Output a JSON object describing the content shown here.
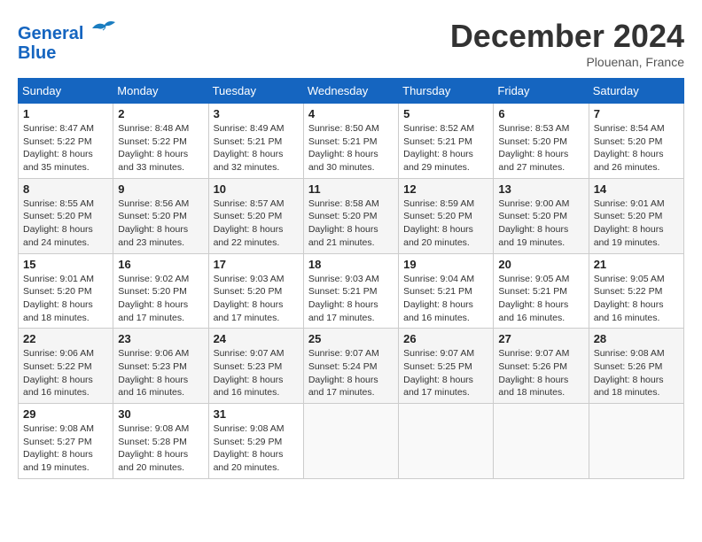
{
  "header": {
    "logo_line1": "General",
    "logo_line2": "Blue",
    "month_title": "December 2024",
    "subtitle": "Plouenan, France"
  },
  "weekdays": [
    "Sunday",
    "Monday",
    "Tuesday",
    "Wednesday",
    "Thursday",
    "Friday",
    "Saturday"
  ],
  "weeks": [
    [
      {
        "day": "1",
        "info": "Sunrise: 8:47 AM\nSunset: 5:22 PM\nDaylight: 8 hours\nand 35 minutes."
      },
      {
        "day": "2",
        "info": "Sunrise: 8:48 AM\nSunset: 5:22 PM\nDaylight: 8 hours\nand 33 minutes."
      },
      {
        "day": "3",
        "info": "Sunrise: 8:49 AM\nSunset: 5:21 PM\nDaylight: 8 hours\nand 32 minutes."
      },
      {
        "day": "4",
        "info": "Sunrise: 8:50 AM\nSunset: 5:21 PM\nDaylight: 8 hours\nand 30 minutes."
      },
      {
        "day": "5",
        "info": "Sunrise: 8:52 AM\nSunset: 5:21 PM\nDaylight: 8 hours\nand 29 minutes."
      },
      {
        "day": "6",
        "info": "Sunrise: 8:53 AM\nSunset: 5:20 PM\nDaylight: 8 hours\nand 27 minutes."
      },
      {
        "day": "7",
        "info": "Sunrise: 8:54 AM\nSunset: 5:20 PM\nDaylight: 8 hours\nand 26 minutes."
      }
    ],
    [
      {
        "day": "8",
        "info": "Sunrise: 8:55 AM\nSunset: 5:20 PM\nDaylight: 8 hours\nand 24 minutes."
      },
      {
        "day": "9",
        "info": "Sunrise: 8:56 AM\nSunset: 5:20 PM\nDaylight: 8 hours\nand 23 minutes."
      },
      {
        "day": "10",
        "info": "Sunrise: 8:57 AM\nSunset: 5:20 PM\nDaylight: 8 hours\nand 22 minutes."
      },
      {
        "day": "11",
        "info": "Sunrise: 8:58 AM\nSunset: 5:20 PM\nDaylight: 8 hours\nand 21 minutes."
      },
      {
        "day": "12",
        "info": "Sunrise: 8:59 AM\nSunset: 5:20 PM\nDaylight: 8 hours\nand 20 minutes."
      },
      {
        "day": "13",
        "info": "Sunrise: 9:00 AM\nSunset: 5:20 PM\nDaylight: 8 hours\nand 19 minutes."
      },
      {
        "day": "14",
        "info": "Sunrise: 9:01 AM\nSunset: 5:20 PM\nDaylight: 8 hours\nand 19 minutes."
      }
    ],
    [
      {
        "day": "15",
        "info": "Sunrise: 9:01 AM\nSunset: 5:20 PM\nDaylight: 8 hours\nand 18 minutes."
      },
      {
        "day": "16",
        "info": "Sunrise: 9:02 AM\nSunset: 5:20 PM\nDaylight: 8 hours\nand 17 minutes."
      },
      {
        "day": "17",
        "info": "Sunrise: 9:03 AM\nSunset: 5:20 PM\nDaylight: 8 hours\nand 17 minutes."
      },
      {
        "day": "18",
        "info": "Sunrise: 9:03 AM\nSunset: 5:21 PM\nDaylight: 8 hours\nand 17 minutes."
      },
      {
        "day": "19",
        "info": "Sunrise: 9:04 AM\nSunset: 5:21 PM\nDaylight: 8 hours\nand 16 minutes."
      },
      {
        "day": "20",
        "info": "Sunrise: 9:05 AM\nSunset: 5:21 PM\nDaylight: 8 hours\nand 16 minutes."
      },
      {
        "day": "21",
        "info": "Sunrise: 9:05 AM\nSunset: 5:22 PM\nDaylight: 8 hours\nand 16 minutes."
      }
    ],
    [
      {
        "day": "22",
        "info": "Sunrise: 9:06 AM\nSunset: 5:22 PM\nDaylight: 8 hours\nand 16 minutes."
      },
      {
        "day": "23",
        "info": "Sunrise: 9:06 AM\nSunset: 5:23 PM\nDaylight: 8 hours\nand 16 minutes."
      },
      {
        "day": "24",
        "info": "Sunrise: 9:07 AM\nSunset: 5:23 PM\nDaylight: 8 hours\nand 16 minutes."
      },
      {
        "day": "25",
        "info": "Sunrise: 9:07 AM\nSunset: 5:24 PM\nDaylight: 8 hours\nand 17 minutes."
      },
      {
        "day": "26",
        "info": "Sunrise: 9:07 AM\nSunset: 5:25 PM\nDaylight: 8 hours\nand 17 minutes."
      },
      {
        "day": "27",
        "info": "Sunrise: 9:07 AM\nSunset: 5:26 PM\nDaylight: 8 hours\nand 18 minutes."
      },
      {
        "day": "28",
        "info": "Sunrise: 9:08 AM\nSunset: 5:26 PM\nDaylight: 8 hours\nand 18 minutes."
      }
    ],
    [
      {
        "day": "29",
        "info": "Sunrise: 9:08 AM\nSunset: 5:27 PM\nDaylight: 8 hours\nand 19 minutes."
      },
      {
        "day": "30",
        "info": "Sunrise: 9:08 AM\nSunset: 5:28 PM\nDaylight: 8 hours\nand 20 minutes."
      },
      {
        "day": "31",
        "info": "Sunrise: 9:08 AM\nSunset: 5:29 PM\nDaylight: 8 hours\nand 20 minutes."
      },
      null,
      null,
      null,
      null
    ]
  ]
}
